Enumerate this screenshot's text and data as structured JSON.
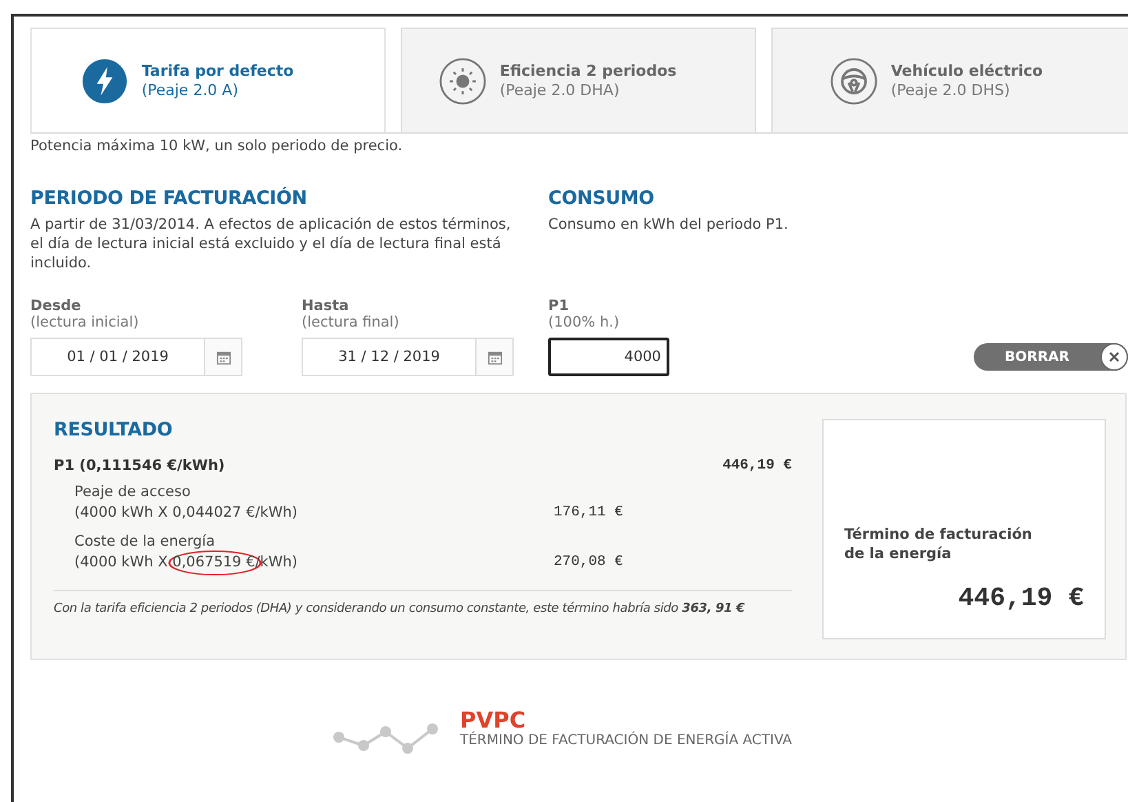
{
  "tabs": [
    {
      "title": "Tarifa por defecto",
      "subtitle": "(Peaje 2.0 A)",
      "kind": "bolt",
      "selected": true
    },
    {
      "title": "Eficiencia 2 periodos",
      "subtitle": "(Peaje 2.0 DHA)",
      "kind": "sun",
      "selected": false
    },
    {
      "title": "Vehículo eléctrico",
      "subtitle": "(Peaje 2.0 DHS)",
      "kind": "wheel",
      "selected": false
    }
  ],
  "tab_description": "Potencia máxima 10 kW, un solo periodo de precio.",
  "billing_period": {
    "heading": "PERIODO DE FACTURACIÓN",
    "text": "A partir de 31/03/2014. A efectos de aplicación de estos términos, el día de lectura inicial está excluido y el día de lectura final está incluido.",
    "fields": [
      {
        "label": "Desde",
        "hint": "(lectura inicial)",
        "value": "01 / 01 / 2019"
      },
      {
        "label": "Hasta",
        "hint": "(lectura final)",
        "value": "31 / 12 / 2019"
      }
    ]
  },
  "consumption": {
    "heading": "CONSUMO",
    "text": "Consumo en kWh del periodo P1.",
    "field": {
      "label": "P1",
      "hint": "(100% h.)",
      "value": "4000"
    },
    "clear_button": "BORRAR"
  },
  "result": {
    "heading": "RESULTADO",
    "period": "P1 (0,111546 €/kWh)",
    "period_total": "446,19 €",
    "lines": [
      {
        "name": "Peaje de acceso",
        "formula": "(4000 kWh X 0,044027 €/kWh)",
        "amount": "176,11 €",
        "circled": false
      },
      {
        "name": "Coste de la energía",
        "formula": "(4000 kWh X 0,067519 €/kWh)",
        "amount": "270,08 €",
        "circled": true
      }
    ],
    "note": "Con la tarifa eficiencia 2 periodos (DHA) y considerando un consumo constante, este término habría sido **363, 91 €**",
    "card": {
      "label": "Término de facturación de la energía",
      "total": "446,19 €"
    }
  },
  "footer": {
    "title": "PVPC",
    "subtitle": "TÉRMINO DE FACTURACIÓN DE ENERGÍA ACTIVA"
  }
}
